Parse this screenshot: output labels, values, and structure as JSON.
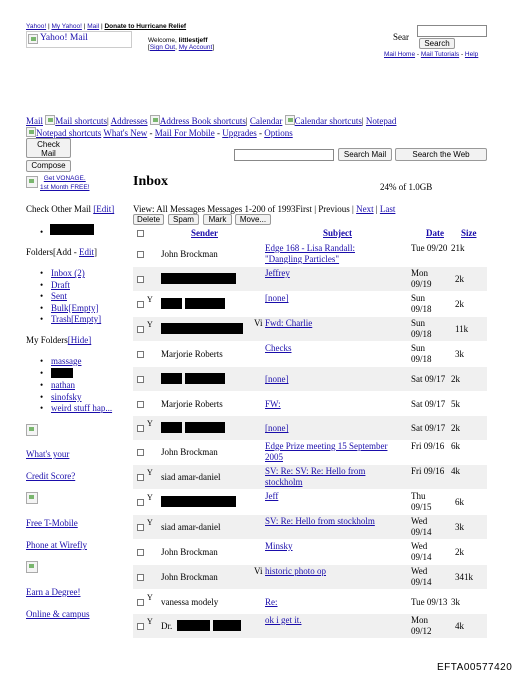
{
  "top_links": {
    "yahoo": "Yahoo!",
    "my_yahoo": "My Yahoo!",
    "mail": "Mail",
    "donate": "Donate to Hurricane Relief"
  },
  "logo_alt": "Yahoo! Mail",
  "welcome": {
    "prefix": "Welcome, ",
    "user": "littlestjeff"
  },
  "account_links": {
    "open": "[",
    "sign_out": "Sign Out",
    "comma": ", ",
    "my_account": "My Account",
    "close": "]"
  },
  "search": {
    "label": "Sear",
    "button": "Search",
    "help_links": {
      "mail_home": "Mail Home",
      "tutorials": "Mail Tutorials",
      "help": "Help",
      "sep": " - "
    }
  },
  "nav": {
    "mail": "Mail",
    "mail_shortcuts": "Mail shortcuts",
    "addresses": "Addresses",
    "address_shortcuts": "Address Book shortcuts",
    "calendar": "Calendar",
    "calendar_shortcuts": "Calendar shortcuts",
    "notepad": "Notepad",
    "notepad_shortcuts": "Notepad shortcuts",
    "whats_new": "What's New",
    "mobile": "Mail For Mobile",
    "upgrades": "Upgrades",
    "options": "Options",
    "sep": "|",
    "dash": "-"
  },
  "buttons": {
    "check_mail_1": "Check",
    "check_mail_2": "Mail",
    "compose": "Compose",
    "search_mail": "Search Mail",
    "search_web": "Search the Web"
  },
  "promo": {
    "vonage_1": "Get VONAGE.",
    "vonage_2": "1st Month FREE!"
  },
  "inbox": {
    "title": "Inbox",
    "usage": "24% of 1.0GB"
  },
  "view_line": {
    "view": "View: All Messages",
    "range": "Messages 1-200 of 1993",
    "first": "First",
    "sep": " | ",
    "previous": "Previous",
    "next": "Next",
    "last": "Last"
  },
  "actions": {
    "delete": "Delete",
    "spam": "Spam",
    "mark": "Mark",
    "move": "Move..."
  },
  "columns": {
    "sender": "Sender",
    "subject": "Subject",
    "date": "Date",
    "size": "Size"
  },
  "sidebar": {
    "check_other": "Check Other Mail",
    "edit": "[Edit]",
    "folders": "Folders",
    "folders_add": "[Add",
    "folders_dash": " - ",
    "folders_edit": "Edit",
    "folders_close": "]",
    "folder_items": [
      "Inbox (2)",
      "Draft",
      "Sent",
      "Bulk[Empty]",
      "Trash[Empty]"
    ],
    "my_folders": "My Folders",
    "hide": "[Hide]",
    "my_folder_items": [
      "massage",
      "",
      "nathan",
      "sinofsky",
      "weird stuff hap..."
    ],
    "ads": {
      "credit_1": "What's your",
      "credit_2": "Credit Score?",
      "tmobile_1": "Free T-Mobile",
      "tmobile_2": "Phone at Wirefly",
      "degree_1": "Earn a Degree!",
      "degree_2": "Online & campus"
    }
  },
  "messages": [
    {
      "flag": "",
      "sender": "John Brockman",
      "subject_1": "Edge 168 - Lisa Randall:",
      "subject_2": "\"Dangling Particles\"",
      "date_1": "Tue 09/20",
      "date_2": "",
      "size": "21k",
      "vi": ""
    },
    {
      "flag": "",
      "sender": "",
      "subject_1": "Jeffrey",
      "subject_2": "",
      "date_1": "Mon",
      "date_2": "09/19",
      "size": "2k",
      "vi": ""
    },
    {
      "flag": "Y",
      "sender": "",
      "subject_1": "[none]",
      "subject_2": "",
      "date_1": "Sun",
      "date_2": "09/18",
      "size": "2k",
      "vi": ""
    },
    {
      "flag": "Y",
      "sender": "",
      "subject_1": "Fwd: Charlie",
      "subject_2": "",
      "date_1": "Sun",
      "date_2": "09/18",
      "size": "11k",
      "vi": "Vi"
    },
    {
      "flag": "",
      "sender": "Marjorie Roberts",
      "subject_1": "Checks",
      "subject_2": "",
      "date_1": "Sun",
      "date_2": "09/18",
      "size": "3k",
      "vi": ""
    },
    {
      "flag": "",
      "sender": "",
      "subject_1": "[none]",
      "subject_2": "",
      "date_1": "Sat 09/17",
      "date_2": "",
      "size": "2k",
      "vi": ""
    },
    {
      "flag": "",
      "sender": "Marjorie Roberts",
      "subject_1": "FW:",
      "subject_2": "",
      "date_1": "Sat 09/17",
      "date_2": "",
      "size": "5k",
      "vi": ""
    },
    {
      "flag": "Y",
      "sender": "",
      "subject_1": "[none]",
      "subject_2": "",
      "date_1": "Sat 09/17",
      "date_2": "",
      "size": "2k",
      "vi": ""
    },
    {
      "flag": "",
      "sender": "John Brockman",
      "subject_1": "Edge Prize meeting 15 September",
      "subject_2": "2005",
      "date_1": "Fri 09/16",
      "date_2": "",
      "size": "6k",
      "vi": ""
    },
    {
      "flag": "Y",
      "sender": "siad amar-daniel",
      "subject_1": "SV: Re: SV: Re: Hello from",
      "subject_2": "stockholm",
      "date_1": "Fri 09/16",
      "date_2": "",
      "size": "4k",
      "vi": ""
    },
    {
      "flag": "Y",
      "sender": "",
      "subject_1": "Jeff",
      "subject_2": "",
      "date_1": "Thu",
      "date_2": "09/15",
      "size": "6k",
      "vi": ""
    },
    {
      "flag": "Y",
      "sender": "siad amar-daniel",
      "subject_1": "SV: Re: Hello from stockholm",
      "subject_2": "",
      "date_1": "Wed",
      "date_2": "09/14",
      "size": "3k",
      "vi": ""
    },
    {
      "flag": "",
      "sender": "John Brockman",
      "subject_1": "Minsky",
      "subject_2": "",
      "date_1": "Wed",
      "date_2": "09/14",
      "size": "2k",
      "vi": ""
    },
    {
      "flag": "",
      "sender": "John Brockman",
      "subject_1": "historic photo op",
      "subject_2": "",
      "date_1": "Wed",
      "date_2": "09/14",
      "size": "341k",
      "vi": "Vi"
    },
    {
      "flag": "Y",
      "sender": "vanessa modely",
      "subject_1": "Re:",
      "subject_2": "",
      "date_1": "Tue 09/13",
      "date_2": "",
      "size": "3k",
      "vi": ""
    },
    {
      "flag": "Y",
      "sender": "Dr.",
      "subject_1": "ok i get it.",
      "subject_2": "",
      "date_1": "Mon",
      "date_2": "09/12",
      "size": "4k",
      "vi": ""
    }
  ],
  "footer_id": "EFTA00577420"
}
